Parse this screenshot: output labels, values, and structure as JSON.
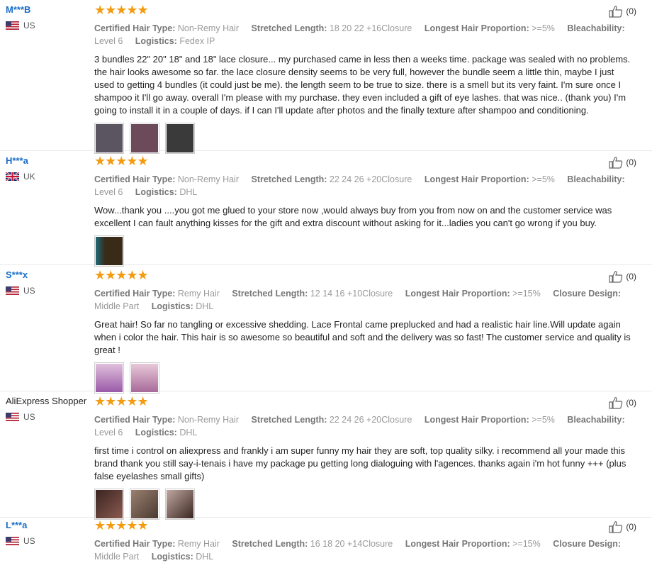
{
  "reviews": [
    {
      "user": "M***B",
      "country": "US",
      "stars": "★★★★★",
      "attributes": [
        {
          "label": "Certified Hair Type:",
          "value": "Non-Remy Hair"
        },
        {
          "label": "Stretched Length:",
          "value": "18 20 22 +16Closure"
        },
        {
          "label": "Longest Hair Proportion:",
          "value": ">=5%"
        },
        {
          "label": "Bleachability:",
          "value": "Level 6"
        },
        {
          "label": "Logistics:",
          "value": "Fedex IP"
        }
      ],
      "text": "3 bundles 22\" 20\" 18\" and 18\" lace closure... my purchased came in less then a weeks time. package was sealed with no problems. the hair looks awesome so far. the lace closure density seems to be very full, however the bundle seem a little thin, maybe I just used to getting 4 bundles (it could just be me). the length seem to be true to size. there is a smell but its very faint. I'm sure once I shampoo it I'll go away. overall I'm please with my purchase. they even included a gift of eye lashes. that was nice.. (thank you) I'm going to install it in a couple of days. if I can I'll update after photos and the finally texture after shampoo and conditioning.",
      "helpful": "(0)",
      "photos": [
        "#5a5560",
        "#6c4a5a",
        "#3a3a3a"
      ]
    },
    {
      "user": "H***a",
      "country": "UK",
      "stars": "★★★★★",
      "attributes": [
        {
          "label": "Certified Hair Type:",
          "value": "Non-Remy Hair"
        },
        {
          "label": "Stretched Length:",
          "value": "22 24 26 +20Closure"
        },
        {
          "label": "Longest Hair Proportion:",
          "value": ">=5%"
        },
        {
          "label": "Bleachability:",
          "value": "Level 6"
        },
        {
          "label": "Logistics:",
          "value": "DHL"
        }
      ],
      "text": "Wow...thank you ....you got me glued to your store now ,would always buy from you from now on and the customer service was excellent I can fault anything kisses for the gift and extra discount without asking for it...ladies you can't go wrong if you buy.",
      "helpful": "(0)",
      "photos": [
        "#3a2a18"
      ]
    },
    {
      "user": "S***x",
      "country": "US",
      "stars": "★★★★★",
      "attributes": [
        {
          "label": "Certified Hair Type:",
          "value": "Remy Hair"
        },
        {
          "label": "Stretched Length:",
          "value": "12 14 16 +10Closure"
        },
        {
          "label": "Longest Hair Proportion:",
          "value": ">=15%"
        },
        {
          "label": "Closure Design:",
          "value": "Middle Part"
        },
        {
          "label": "Logistics:",
          "value": "DHL"
        }
      ],
      "text": "Great hair! So far no tangling or excessive shedding. Lace Frontal came preplucked and had a realistic hair line.Will update again when i color the hair. This hair is so awesome so beautiful and soft and the delivery was so fast! The customer service and quality is great !",
      "helpful": "(0)",
      "photos": [
        "#b07ab8",
        "#c58aae"
      ]
    },
    {
      "user": "AliExpress Shopper",
      "country": "US",
      "stars": "★★★★★",
      "attributes": [
        {
          "label": "Certified Hair Type:",
          "value": "Non-Remy Hair"
        },
        {
          "label": "Stretched Length:",
          "value": "22 24 26 +20Closure"
        },
        {
          "label": "Longest Hair Proportion:",
          "value": ">=5%"
        },
        {
          "label": "Bleachability:",
          "value": "Level 6"
        },
        {
          "label": "Logistics:",
          "value": "DHL"
        }
      ],
      "text": "first time i control on aliexpress and frankly i am super funny my hair they are soft, top quality silky. i recommend all your made this brand thank you still say-i-tenais i have my package pu getting long dialoguing with l'agences. thanks again i'm hot funny +++ (plus false eyelashes small gifts)",
      "helpful": "(0)",
      "photos": [
        "#5a3a30",
        "#7a6050",
        "#5a4035"
      ]
    },
    {
      "user": "L***a",
      "country": "US",
      "stars": "★★★★★",
      "attributes": [
        {
          "label": "Certified Hair Type:",
          "value": "Remy Hair"
        },
        {
          "label": "Stretched Length:",
          "value": "16 18 20 +14Closure"
        },
        {
          "label": "Longest Hair Proportion:",
          "value": ">=15%"
        },
        {
          "label": "Closure Design:",
          "value": "Middle Part"
        },
        {
          "label": "Logistics:",
          "value": "DHL"
        }
      ],
      "text": "",
      "helpful": "(0)",
      "photos": []
    }
  ]
}
